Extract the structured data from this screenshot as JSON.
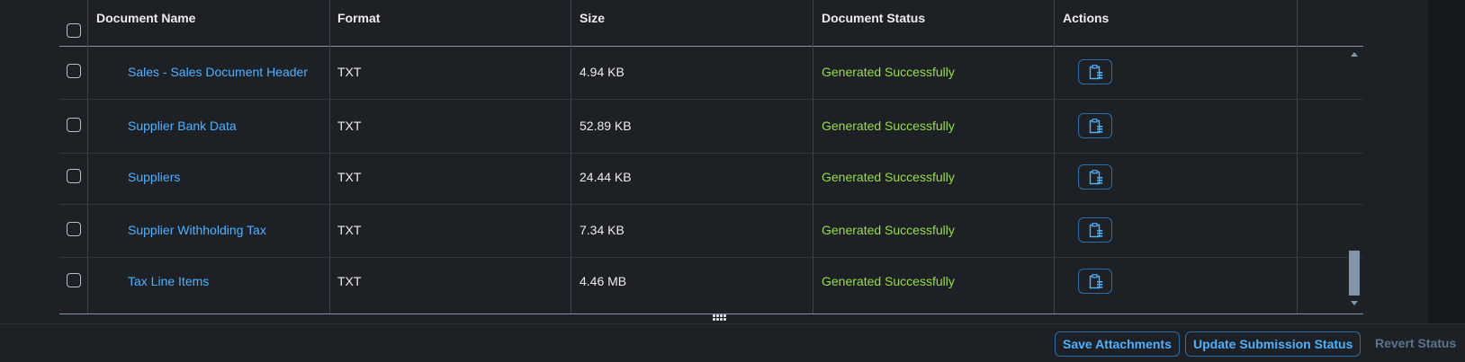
{
  "table": {
    "headers": {
      "name": "Document Name",
      "format": "Format",
      "size": "Size",
      "status": "Document Status",
      "actions": "Actions"
    },
    "rows": [
      {
        "name": "Sales - Sales Document Header",
        "format": "TXT",
        "size": "4.94 KB",
        "status": "Generated Successfully"
      },
      {
        "name": "Supplier Bank Data",
        "format": "TXT",
        "size": "52.89 KB",
        "status": "Generated Successfully"
      },
      {
        "name": "Suppliers",
        "format": "TXT",
        "size": "24.44 KB",
        "status": "Generated Successfully"
      },
      {
        "name": "Supplier Withholding Tax",
        "format": "TXT",
        "size": "7.34 KB",
        "status": "Generated Successfully"
      },
      {
        "name": "Tax Line Items",
        "format": "TXT",
        "size": "4.46 MB",
        "status": "Generated Successfully"
      }
    ],
    "action_icon": "clipboard-list-icon"
  },
  "footer": {
    "save_attachments": "Save Attachments",
    "update_submission_status": "Update Submission Status",
    "revert_status": "Revert Status"
  },
  "colors": {
    "link": "#4db1ff",
    "status_success": "#97dd40",
    "background": "#1d2126"
  }
}
